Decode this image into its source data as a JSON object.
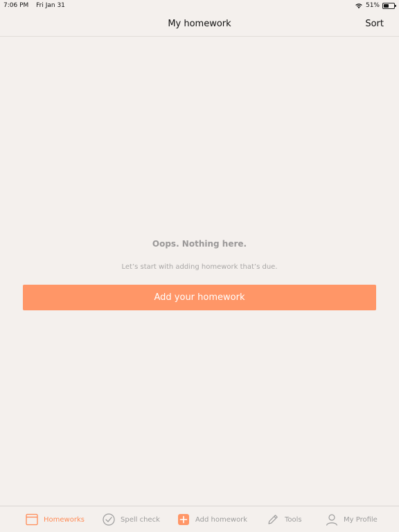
{
  "status_bar": {
    "time": "7:06 PM",
    "date": "Fri Jan 31",
    "battery_percent_label": "51%",
    "battery_level": 0.51
  },
  "nav": {
    "title": "My homework",
    "sort_label": "Sort"
  },
  "empty_state": {
    "title": "Oops. Nothing here.",
    "subtitle": "Let’s start with adding homework that’s due.",
    "button_label": "Add your homework"
  },
  "tabs": [
    {
      "label": "Homeworks",
      "icon": "calendar-icon",
      "active": true
    },
    {
      "label": "Spell check",
      "icon": "check-circle-icon",
      "active": false
    },
    {
      "label": "Add homework",
      "icon": "plus-square-icon",
      "active": false
    },
    {
      "label": "Tools",
      "icon": "pencil-icon",
      "active": false
    },
    {
      "label": "My Profile",
      "icon": "person-icon",
      "active": false
    }
  ],
  "colors": {
    "accent": "#ff9667",
    "background": "#f4f0ed",
    "inactive_tab": "#9c9c9c"
  }
}
